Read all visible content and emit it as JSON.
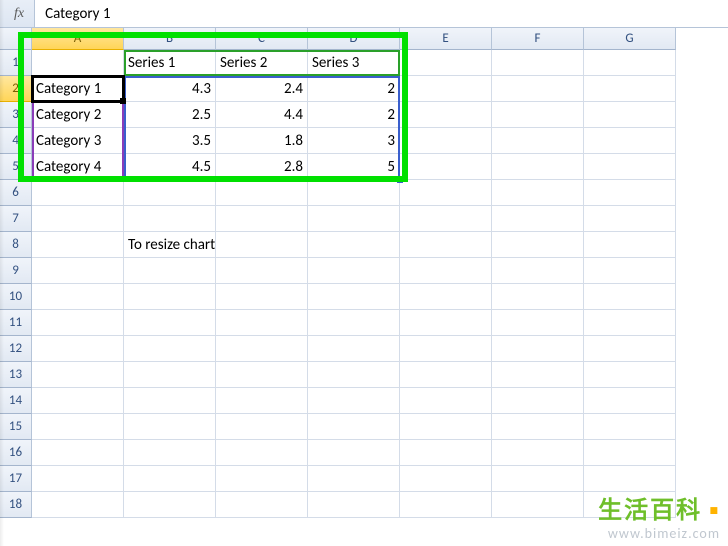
{
  "formula_bar": {
    "fx": "fx",
    "value": "Category 1"
  },
  "columns": [
    "A",
    "B",
    "C",
    "D",
    "E",
    "F",
    "G"
  ],
  "rows": [
    1,
    2,
    3,
    4,
    5,
    6,
    7,
    8,
    9,
    10,
    11,
    12,
    13,
    14,
    15,
    16,
    17,
    18
  ],
  "selection": {
    "col": "A",
    "row": 2
  },
  "cells": {
    "B1": "Series 1",
    "C1": "Series 2",
    "D1": "Series 3",
    "A2": "Category 1",
    "B2": "4.3",
    "C2": "2.4",
    "D2": "2",
    "A3": "Category 2",
    "B3": "2.5",
    "C3": "4.4",
    "D3": "2",
    "A4": "Category 3",
    "B4": "3.5",
    "C4": "1.8",
    "D4": "3",
    "A5": "Category 4",
    "B5": "4.5",
    "C5": "2.8",
    "D5": "5",
    "B8": "To resize chart data range, drag lower right corner of range."
  },
  "watermark": {
    "brand": "生活百科",
    "url": "www.bimeiz.com"
  },
  "chart_data": {
    "type": "table",
    "categories": [
      "Category 1",
      "Category 2",
      "Category 3",
      "Category 4"
    ],
    "series": [
      {
        "name": "Series 1",
        "values": [
          4.3,
          2.5,
          3.5,
          4.5
        ]
      },
      {
        "name": "Series 2",
        "values": [
          2.4,
          4.4,
          1.8,
          2.8
        ]
      },
      {
        "name": "Series 3",
        "values": [
          2,
          2,
          3,
          5
        ]
      }
    ],
    "note": "To resize chart data range, drag lower right corner of range."
  }
}
